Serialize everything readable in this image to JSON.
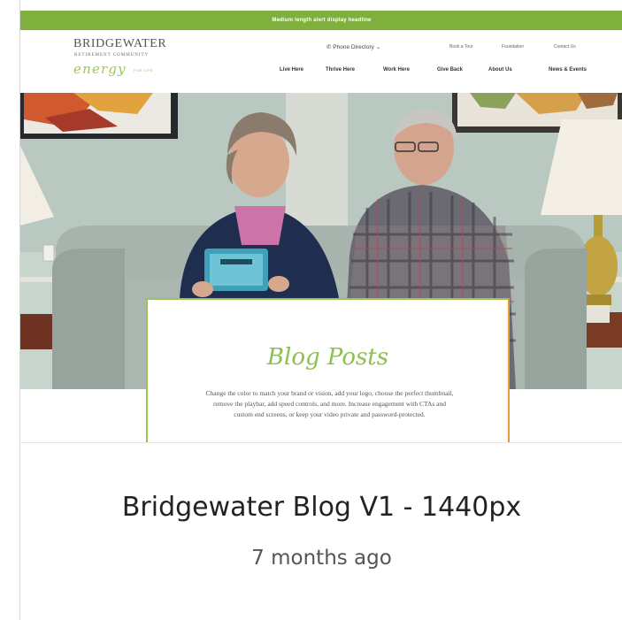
{
  "thumbnail": {
    "announcement": "Medium length alert display headline",
    "logo": {
      "name": "BRIDGEWATER",
      "subtitle": "RETIREMENT COMMUNITY",
      "tagline": "energy",
      "tagline_suffix": "FOR LIFE"
    },
    "phone_label": "Phone Directory",
    "utility_nav": [
      "Book a Tour",
      "Foundation",
      "Contact Us"
    ],
    "main_nav": [
      "Live Here",
      "Thrive Here",
      "Work Here",
      "Give Back",
      "About Us",
      "News & Events"
    ],
    "hero_title": "Blog Posts",
    "hero_description": "Change the color to match your brand or vision, add your logo, choose the perfect thumbnail, remove the playbar, add speed controls, and more. Increase engagement with CTAs and custom end screens, or keep your video private and password-protected."
  },
  "card": {
    "title": "Bridgewater Blog V1 - 1440px",
    "meta": "7 months ago"
  },
  "colors": {
    "announcement_bar": "#7fb03d",
    "accent_green": "#8cc04f",
    "accent_orange": "#e39a3b"
  }
}
